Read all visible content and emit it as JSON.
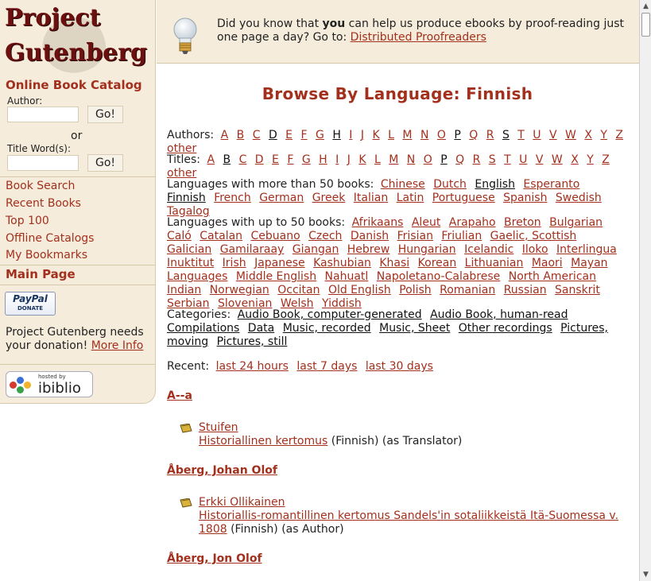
{
  "logo": {
    "line1": "Project",
    "line2": "Gutenberg"
  },
  "sidebar": {
    "catalog_title": "Online Book Catalog",
    "author_label": "Author:",
    "go_label": "Go!",
    "or_label": "or",
    "title_label": "Title Word(s):",
    "links": [
      "Book Search",
      "Recent Books",
      "Top 100",
      "Offline Catalogs",
      "My Bookmarks"
    ],
    "main_page": "Main Page",
    "paypal": {
      "line1": "PayPal",
      "line2": "DONATE"
    },
    "donate_text": "Project Gutenberg needs your donation!",
    "more_info": "More Info",
    "ibiblio": {
      "hosted_by": "hosted by",
      "name": "ibiblio"
    }
  },
  "header": {
    "tip_pre": "Did you know that ",
    "tip_bold": "you",
    "tip_mid": " can help us produce ebooks by proof-reading just one page a day? Go to: ",
    "tip_link": "Distributed Proofreaders"
  },
  "main": {
    "title": "Browse By Language: Finnish",
    "authors_label": "Authors:",
    "titles_label": "Titles:",
    "author_letters": [
      "A",
      "B",
      "C",
      "D",
      "E",
      "F",
      "G",
      "H",
      "I",
      "J",
      "K",
      "L",
      "M",
      "N",
      "O",
      "P",
      "Q",
      "R",
      "S",
      "T",
      "U",
      "V",
      "W",
      "X",
      "Y",
      "Z",
      "other"
    ],
    "author_letters_dark": [
      "D",
      "H",
      "P",
      "S"
    ],
    "title_letters": [
      "A",
      "B",
      "C",
      "D",
      "E",
      "F",
      "G",
      "H",
      "I",
      "J",
      "K",
      "L",
      "M",
      "N",
      "O",
      "P",
      "Q",
      "R",
      "S",
      "T",
      "U",
      "V",
      "W",
      "X",
      "Y",
      "Z",
      "other"
    ],
    "title_letters_dark": [
      "B",
      "P"
    ],
    "langs_more_label": "Languages with more than 50 books:",
    "langs_more": [
      "Chinese",
      "Dutch",
      "English",
      "Esperanto",
      "Finnish",
      "French",
      "German",
      "Greek",
      "Italian",
      "Latin",
      "Portuguese",
      "Spanish",
      "Swedish",
      "Tagalog"
    ],
    "langs_more_dark": [
      "English",
      "Finnish"
    ],
    "langs_up_label": "Languages with up to 50 books:",
    "langs_up": [
      "Afrikaans",
      "Aleut",
      "Arapaho",
      "Breton",
      "Bulgarian",
      "Caló",
      "Catalan",
      "Cebuano",
      "Czech",
      "Danish",
      "Frisian",
      "Friulian",
      "Gaelic, Scottish",
      "Galician",
      "Gamilaraay",
      "Giangan",
      "Hebrew",
      "Hungarian",
      "Icelandic",
      "Iloko",
      "Interlingua",
      "Inuktitut",
      "Irish",
      "Japanese",
      "Kashubian",
      "Khasi",
      "Korean",
      "Lithuanian",
      "Maori",
      "Mayan Languages",
      "Middle English",
      "Nahuatl",
      "Napoletano-Calabrese",
      "North American Indian",
      "Norwegian",
      "Occitan",
      "Old English",
      "Polish",
      "Romanian",
      "Russian",
      "Sanskrit",
      "Serbian",
      "Slovenian",
      "Welsh",
      "Yiddish"
    ],
    "categories_label": "Categories:",
    "categories": [
      "Audio Book, computer-generated",
      "Audio Book, human-read",
      "Compilations",
      "Data",
      "Music, recorded",
      "Music, Sheet",
      "Other recordings",
      "Pictures, moving",
      "Pictures, still"
    ],
    "recent_label": "Recent:",
    "recent": [
      "last 24 hours",
      "last 7 days",
      "last 30 days"
    ],
    "entries": [
      {
        "author": "A--a",
        "book_title": "Stuifen",
        "book_sub": "Historiallinen kertomus",
        "lang": " (Finnish) (as Translator)"
      },
      {
        "author": "Åberg, Johan Olof",
        "book_title": "Erkki Ollikainen",
        "book_sub": "Historiallis-romantillinen kertomus Sandels'in sotaliikkeistä Itä-Suomessa v. 1808",
        "lang": " (Finnish) (as Author)"
      },
      {
        "author": "Åberg, Jon Olof"
      }
    ]
  },
  "colors": {
    "link": "#a3301d",
    "panel": "#f5ecdc",
    "border": "#d7c8aa"
  }
}
